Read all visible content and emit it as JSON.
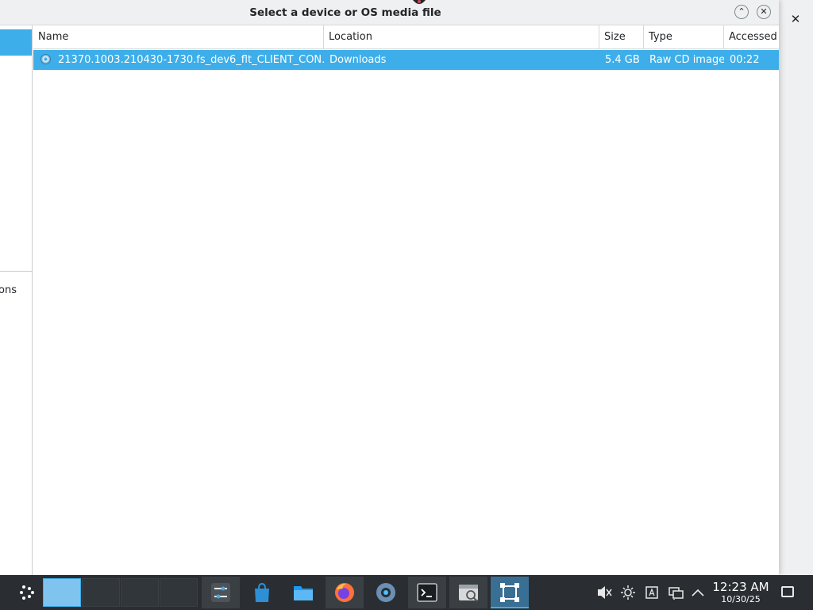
{
  "dialog": {
    "title": "Select a device or OS media file",
    "minimize_icon": "chevron-up-icon",
    "close_icon": "close-icon",
    "minimize_glyph": "⌃",
    "close_glyph": "✕"
  },
  "background_window": {
    "close_glyph": "✕"
  },
  "sidebar": {
    "partial_label": "ons"
  },
  "file_list": {
    "columns": [
      "Name",
      "Location",
      "Size",
      "Type",
      "Accessed"
    ],
    "rows": [
      {
        "name": "21370.1003.210430-1730.fs_dev6_flt_CLIENT_CON...",
        "location": "Downloads",
        "size": "5.4 GB",
        "type": "Raw CD image",
        "accessed": "00:22",
        "icon": "disc-image-icon",
        "selected": true
      }
    ]
  },
  "taskbar": {
    "launcher_icon": "application-launcher-icon",
    "apps": [
      {
        "icon": "system-settings-icon",
        "state": "open"
      },
      {
        "icon": "discover-store-icon",
        "state": "idle"
      },
      {
        "icon": "file-manager-icon",
        "state": "idle"
      },
      {
        "icon": "firefox-icon",
        "state": "open"
      },
      {
        "icon": "settings-gear-icon",
        "state": "idle"
      },
      {
        "icon": "terminal-icon",
        "state": "open"
      },
      {
        "icon": "disk-utility-icon",
        "state": "open"
      },
      {
        "icon": "virt-manager-icon",
        "state": "active"
      }
    ],
    "tray": {
      "volume_icon": "volume-muted-icon",
      "brightness_icon": "brightness-icon",
      "keyboard_icon": "keyboard-layout-icon",
      "network_icon": "network-wired-icon",
      "expand_icon": "chevron-up-icon"
    },
    "clock": {
      "time": "12:23 AM",
      "date": "10/30/25"
    }
  },
  "colors": {
    "selection": "#3daee9",
    "taskbar": "#2a2e32",
    "window_bg": "#eff0f1"
  }
}
